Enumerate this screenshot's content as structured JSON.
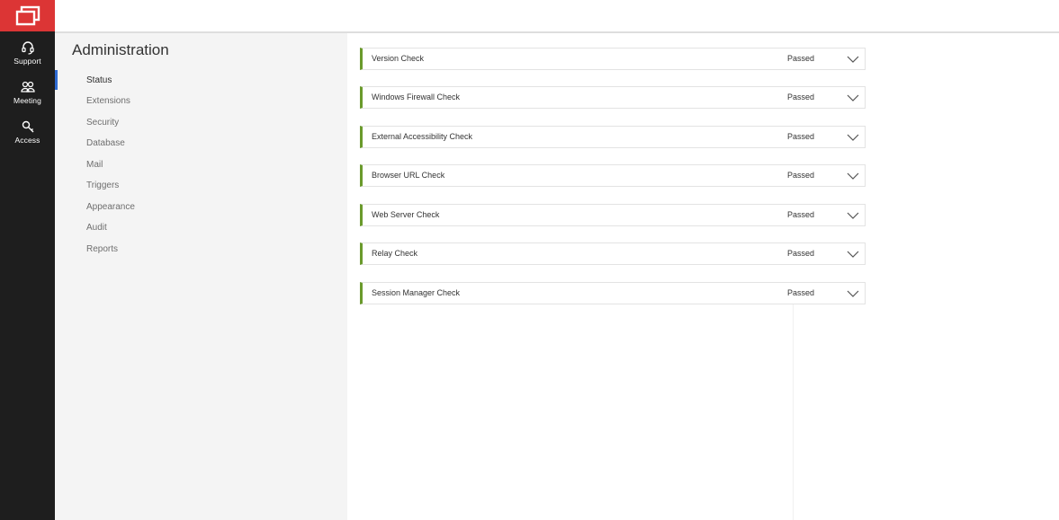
{
  "rail": {
    "items": [
      {
        "label": "Support",
        "icon": "headset-icon"
      },
      {
        "label": "Meeting",
        "icon": "people-icon"
      },
      {
        "label": "Access",
        "icon": "key-icon"
      }
    ]
  },
  "admin": {
    "title": "Administration",
    "menu": [
      {
        "label": "Status",
        "active": true
      },
      {
        "label": "Extensions"
      },
      {
        "label": "Security"
      },
      {
        "label": "Database"
      },
      {
        "label": "Mail"
      },
      {
        "label": "Triggers"
      },
      {
        "label": "Appearance"
      },
      {
        "label": "Audit"
      },
      {
        "label": "Reports"
      }
    ]
  },
  "checks": [
    {
      "name": "Version Check",
      "status": "Passed"
    },
    {
      "name": "Windows Firewall Check",
      "status": "Passed"
    },
    {
      "name": "External Accessibility Check",
      "status": "Passed"
    },
    {
      "name": "Browser URL Check",
      "status": "Passed"
    },
    {
      "name": "Web Server Check",
      "status": "Passed"
    },
    {
      "name": "Relay Check",
      "status": "Passed"
    },
    {
      "name": "Session Manager Check",
      "status": "Passed"
    }
  ],
  "colors": {
    "brand": "#dc3535",
    "rail_bg": "#1e1e1e",
    "passed_accent": "#6a9a2c",
    "active_indicator": "#2f6bd2"
  }
}
